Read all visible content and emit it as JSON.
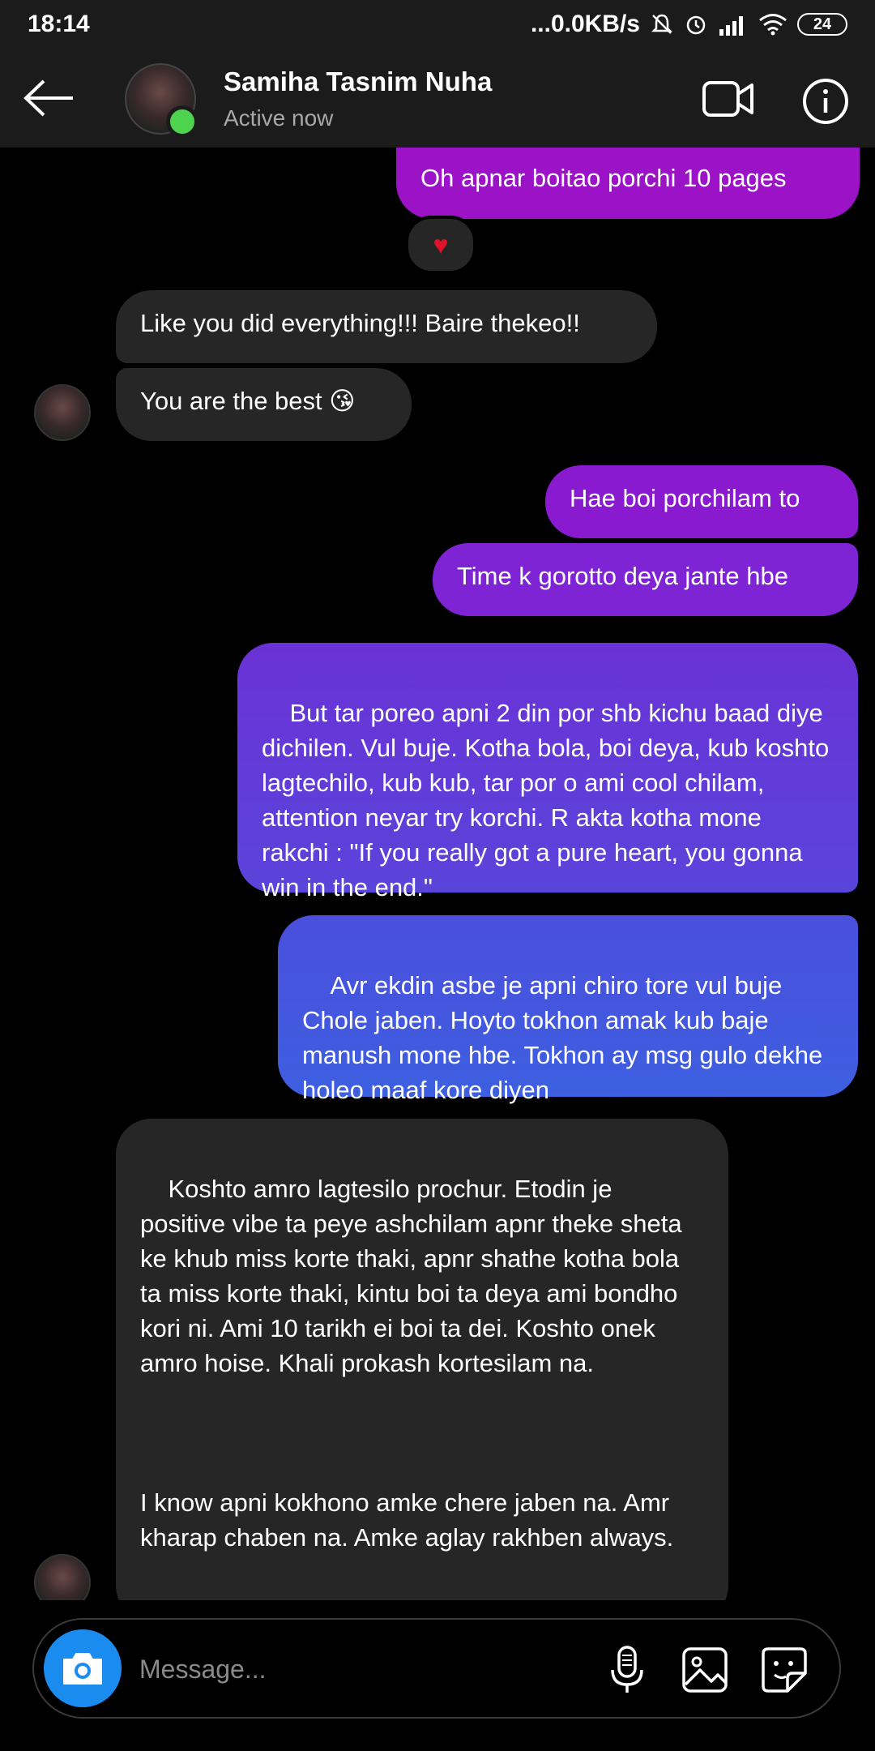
{
  "status_bar": {
    "time": "18:14",
    "network_speed": "...0.0KB/s",
    "battery": "24",
    "icons": [
      "mute-icon",
      "alarm-icon",
      "signal-icon",
      "wifi-icon",
      "battery-icon"
    ]
  },
  "header": {
    "contact_name": "Samiha Tasnim Nuha",
    "contact_status": "Active now",
    "online_color": "#4ed34e"
  },
  "messages": [
    {
      "side": "out",
      "text": "Oh apnar boitao porchi 10 pages",
      "reaction": "♥"
    },
    {
      "side": "in",
      "text": "Like you did everything!!! Baire thekeo!!"
    },
    {
      "side": "in",
      "text": "You are the best 😘"
    },
    {
      "side": "out",
      "text": "Hae boi porchilam to"
    },
    {
      "side": "out",
      "text": "Time k gorotto deya jante hbe"
    },
    {
      "side": "out",
      "text": "But tar poreo apni 2 din por shb kichu baad diye dichilen. Vul buje. Kotha bola, boi deya, kub koshto lagtechilo, kub kub, tar por o ami cool chilam, attention neyar try korchi. R akta kotha mone rakchi : \"If you really got a pure heart, you gonna win in the end.\""
    },
    {
      "side": "out",
      "text": "Avr ekdin asbe je apni chiro tore vul buje Chole jaben. Hoyto tokhon amak kub baje manush mone hbe. Tokhon ay msg gulo dekhe holeo maaf kore diyen"
    },
    {
      "side": "in",
      "text": "Koshto amro lagtesilo prochur. Etodin je positive vibe ta peye ashchilam apnr theke sheta ke khub miss korte thaki, apnr shathe kotha bola ta miss korte thaki, kintu boi ta deya ami bondho kori ni. Ami 10 tarikh ei boi ta dei. Koshto onek amro hoise. Khali prokash kortesilam na.\n\n\n\nI know apni kokhono amke chere jaben na. Amr kharap chaben na. Amke aglay rakhben always."
    }
  ],
  "composer": {
    "placeholder": "Message..."
  },
  "colors": {
    "outgoing_top": "#9b13c9",
    "outgoing_bottom": "#3b63e0",
    "incoming": "#262626",
    "camera": "#1a8cf0"
  }
}
